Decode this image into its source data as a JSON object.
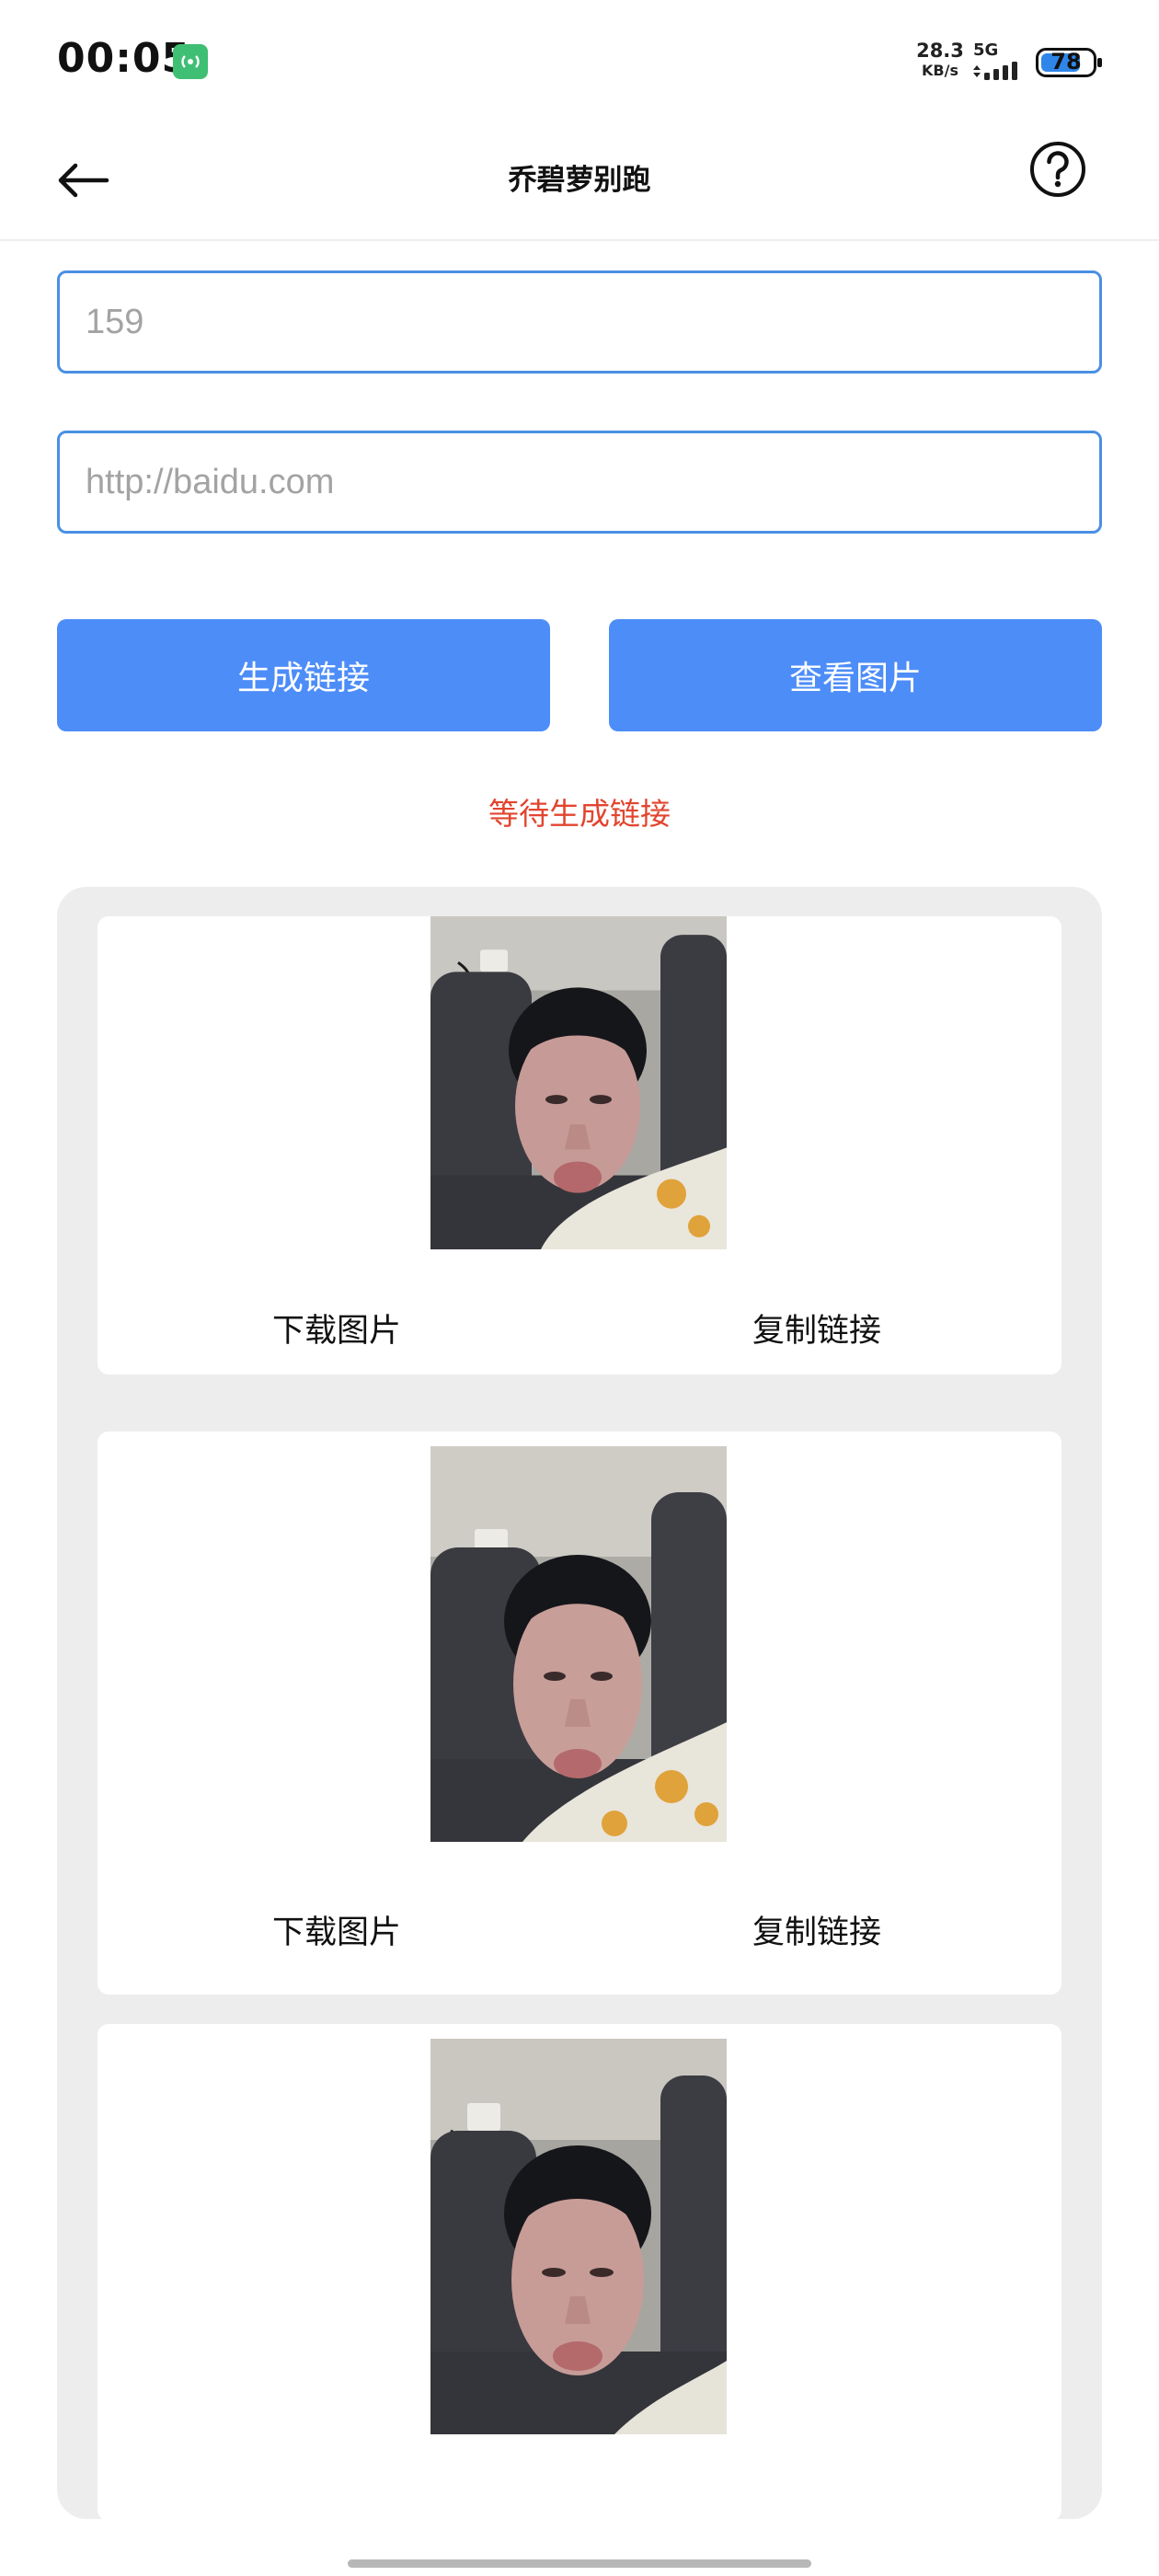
{
  "status_bar": {
    "time": "00:05",
    "net_speed_value": "28.3",
    "net_speed_unit": "KB/s",
    "network_type": "5G",
    "battery_level": "78",
    "battery_fraction": 0.78,
    "icons": [
      "hotspot-icon",
      "signal-icon",
      "battery-icon"
    ]
  },
  "app_bar": {
    "title": "乔碧萝别跑",
    "icons": [
      "back-arrow-icon",
      "help-icon"
    ]
  },
  "form": {
    "field1_placeholder": "159",
    "field2_placeholder": "http://baidu.com",
    "generate_button": "生成链接",
    "view_button": "查看图片",
    "status_message": "等待生成链接",
    "colors": {
      "accent": "#4d8df8",
      "input_border": "#4a90e2",
      "status": "#e2452f"
    }
  },
  "gallery": {
    "cards": [
      {
        "download_label": "下载图片",
        "copy_label": "复制链接"
      },
      {
        "download_label": "下载图片",
        "copy_label": "复制链接"
      },
      {}
    ]
  }
}
